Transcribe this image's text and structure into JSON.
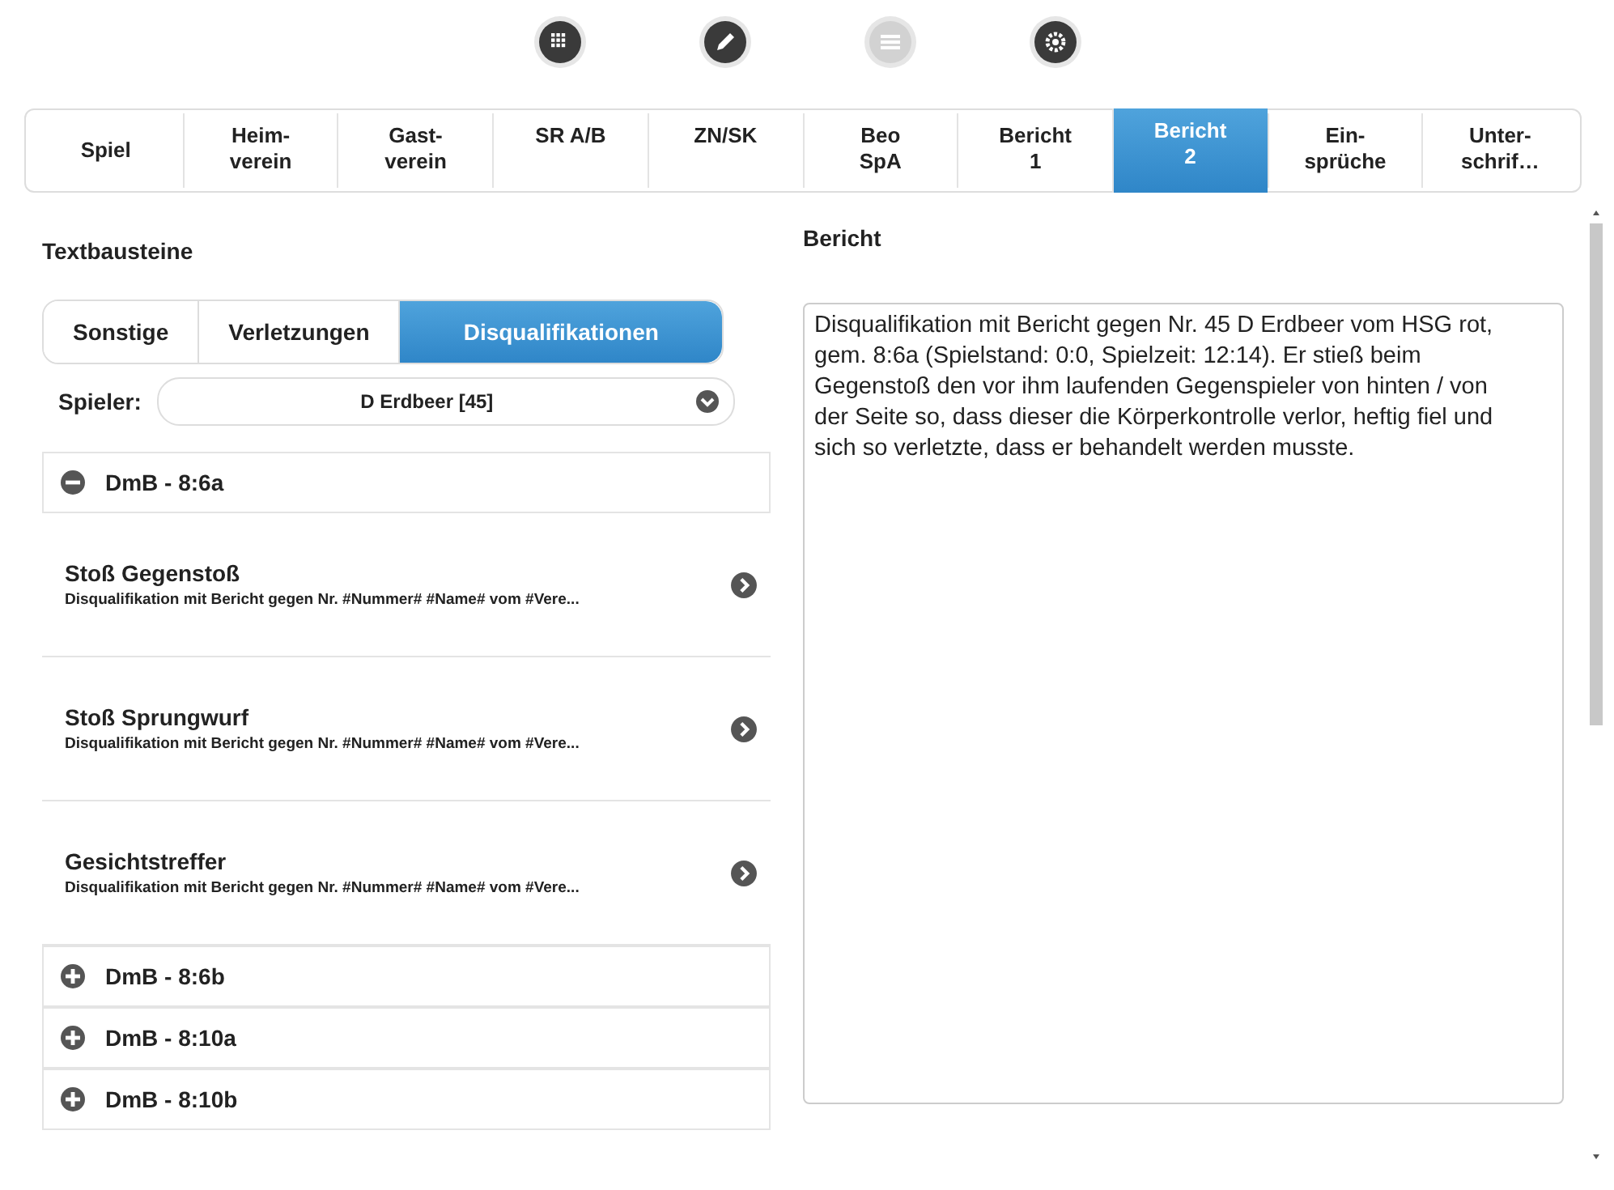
{
  "toolbar": [
    {
      "kind": "grid",
      "disabled": false
    },
    {
      "kind": "pencil",
      "disabled": false
    },
    {
      "kind": "list",
      "disabled": true
    },
    {
      "kind": "gear",
      "disabled": false
    }
  ],
  "tabs": [
    {
      "label": "Spiel",
      "selected": false
    },
    {
      "label": "Heim-\nverein",
      "selected": false
    },
    {
      "label": "Gast-\nverein",
      "selected": false
    },
    {
      "label": "SR A/B",
      "selected": false
    },
    {
      "label": "ZN/SK",
      "selected": false
    },
    {
      "label": "Beo\nSpA",
      "selected": false
    },
    {
      "label": "Bericht\n1",
      "selected": false
    },
    {
      "label": "Bericht\n2",
      "selected": true
    },
    {
      "label": "Ein-\nsprüche",
      "selected": false
    },
    {
      "label": "Unter-\nschrif…",
      "selected": false
    }
  ],
  "textbausteine": {
    "heading": "Textbausteine",
    "segments": [
      {
        "label": "Sonstige",
        "selected": false
      },
      {
        "label": "Verletzungen",
        "selected": false
      },
      {
        "label": "Disqualifikationen",
        "selected": true
      }
    ],
    "player": {
      "label": "Spieler:",
      "value": "D Erdbeer [45]"
    },
    "groups": [
      {
        "title": "DmB - 8:6a",
        "expanded": true,
        "items": [
          {
            "title": "Stoß Gegenstoß",
            "text": "Disqualifikation mit Bericht gegen Nr. #Nummer# #Name# vom #Vere..."
          },
          {
            "title": "Stoß Sprungwurf",
            "text": "Disqualifikation mit Bericht gegen Nr. #Nummer# #Name# vom #Vere..."
          },
          {
            "title": "Gesichtstreffer",
            "text": "Disqualifikation mit Bericht gegen Nr. #Nummer# #Name# vom #Vere..."
          }
        ]
      },
      {
        "title": "DmB - 8:6b",
        "expanded": false
      },
      {
        "title": "DmB - 8:10a",
        "expanded": false
      },
      {
        "title": "DmB - 8:10b",
        "expanded": false
      }
    ]
  },
  "bericht": {
    "heading": "Bericht",
    "value": "Disqualifikation mit Bericht gegen Nr. 45 D Erdbeer vom HSG rot, gem. 8:6a (Spielstand: 0:0, Spielzeit: 12:14). Er stieß beim Gegenstoß den vor ihm laufenden Gegenspieler von hinten / von der Seite so, dass dieser die Körperkontrolle verlor, heftig fiel und sich so verletzte, dass er behandelt werden musste."
  }
}
